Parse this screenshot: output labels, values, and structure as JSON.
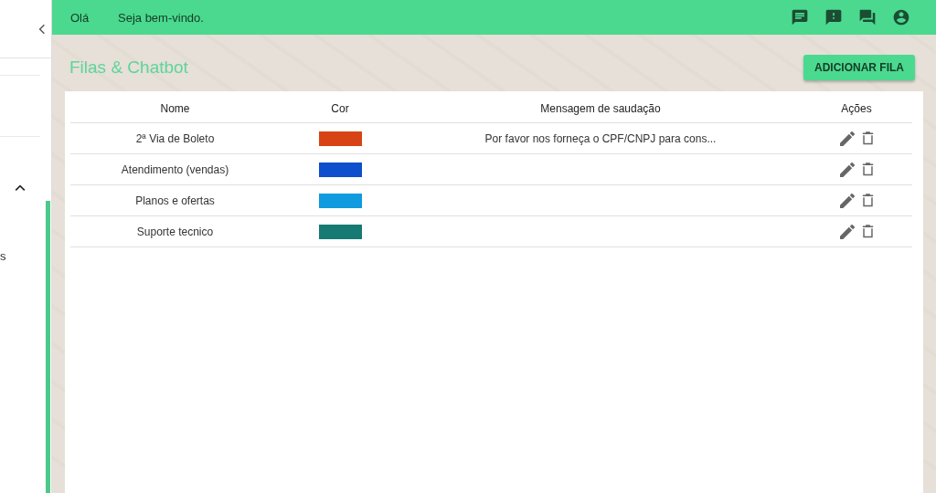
{
  "sidebar": {
    "cut_text": "s"
  },
  "topbar": {
    "greeting": "Olá",
    "welcome": "Seja bem-vindo."
  },
  "page": {
    "title": "Filas & Chatbot",
    "add_button": "ADICIONAR FILA"
  },
  "table": {
    "columns": [
      "Nome",
      "Cor",
      "Mensagem de saudação",
      "Ações"
    ],
    "rows": [
      {
        "name": "2ª Via de Boleto",
        "color": "#d84315",
        "message": "Por favor nos forneça o CPF/CNPJ para cons..."
      },
      {
        "name": "Atendimento (vendas)",
        "color": "#0d4fcc",
        "message": ""
      },
      {
        "name": "Planos e ofertas",
        "color": "#0f9bdd",
        "message": ""
      },
      {
        "name": "Suporte tecnico",
        "color": "#167a72",
        "message": ""
      }
    ]
  }
}
